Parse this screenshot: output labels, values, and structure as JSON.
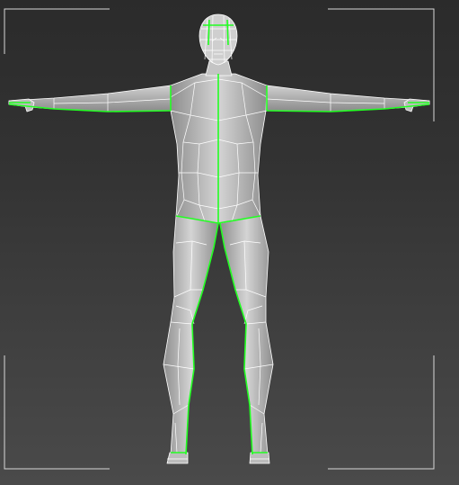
{
  "viewport": {
    "view": "front",
    "shading": "default-shading-with-edged-faces"
  },
  "colors": {
    "background_top": "#2b2b2b",
    "background_bottom": "#4a4a4a",
    "mesh_fill": "#c8c8c8",
    "wireframe": "#ffffff",
    "selected_edges": "#22ff22",
    "safe_frame": "#d8d8d8"
  },
  "model": {
    "name": "",
    "pose": "T-pose",
    "icon": "human-body-mesh-icon"
  }
}
